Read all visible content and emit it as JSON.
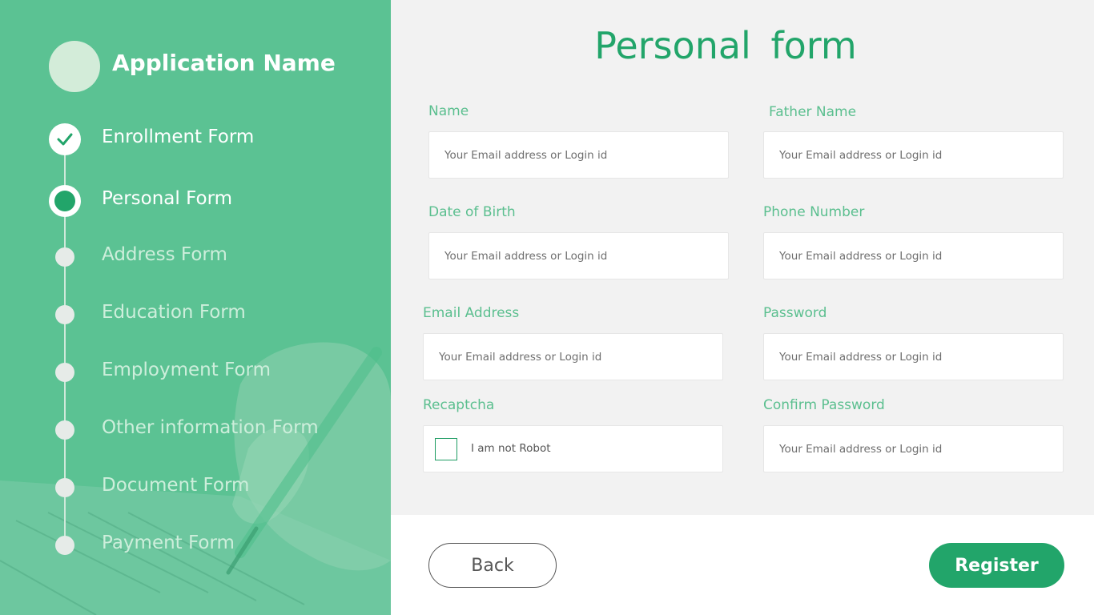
{
  "app": {
    "name": "Application Name"
  },
  "sidebar": {
    "steps": [
      {
        "label": "Enrollment Form",
        "status": "completed"
      },
      {
        "label": "Personal Form",
        "status": "current"
      },
      {
        "label": "Address Form",
        "status": "pending"
      },
      {
        "label": "Education Form",
        "status": "pending"
      },
      {
        "label": "Employment Form",
        "status": "pending"
      },
      {
        "label": "Other information Form",
        "status": "pending"
      },
      {
        "label": "Document Form",
        "status": "pending"
      },
      {
        "label": "Payment Form",
        "status": "pending"
      }
    ]
  },
  "form": {
    "title": "Personal  form",
    "fields": {
      "name": {
        "label": "Name",
        "placeholder": "Your Email address or Login id",
        "value": ""
      },
      "father_name": {
        "label": "Father Name",
        "placeholder": "Your Email address or Login id",
        "value": ""
      },
      "dob": {
        "label": "Date of Birth",
        "placeholder": "Your Email address or Login id",
        "value": ""
      },
      "phone": {
        "label": "Phone Number",
        "placeholder": "Your Email address or Login id",
        "value": ""
      },
      "email": {
        "label": "Email Address",
        "placeholder": "Your Email address or Login id",
        "value": ""
      },
      "password": {
        "label": "Password",
        "placeholder": "Your Email address or Login id",
        "value": ""
      },
      "recaptcha": {
        "label": "Recaptcha",
        "checkbox_text": "I am not Robot",
        "checked": false
      },
      "confirm_password": {
        "label": "Confirm Password",
        "placeholder": "Your Email address or Login id",
        "value": ""
      }
    },
    "buttons": {
      "back": "Back",
      "register": "Register"
    }
  },
  "colors": {
    "sidebar_bg": "#5bc293",
    "accent": "#22a56a",
    "label": "#5bbf8f",
    "page_bg": "#f2f2f2"
  },
  "icons": {
    "completed_step": "check-icon"
  }
}
